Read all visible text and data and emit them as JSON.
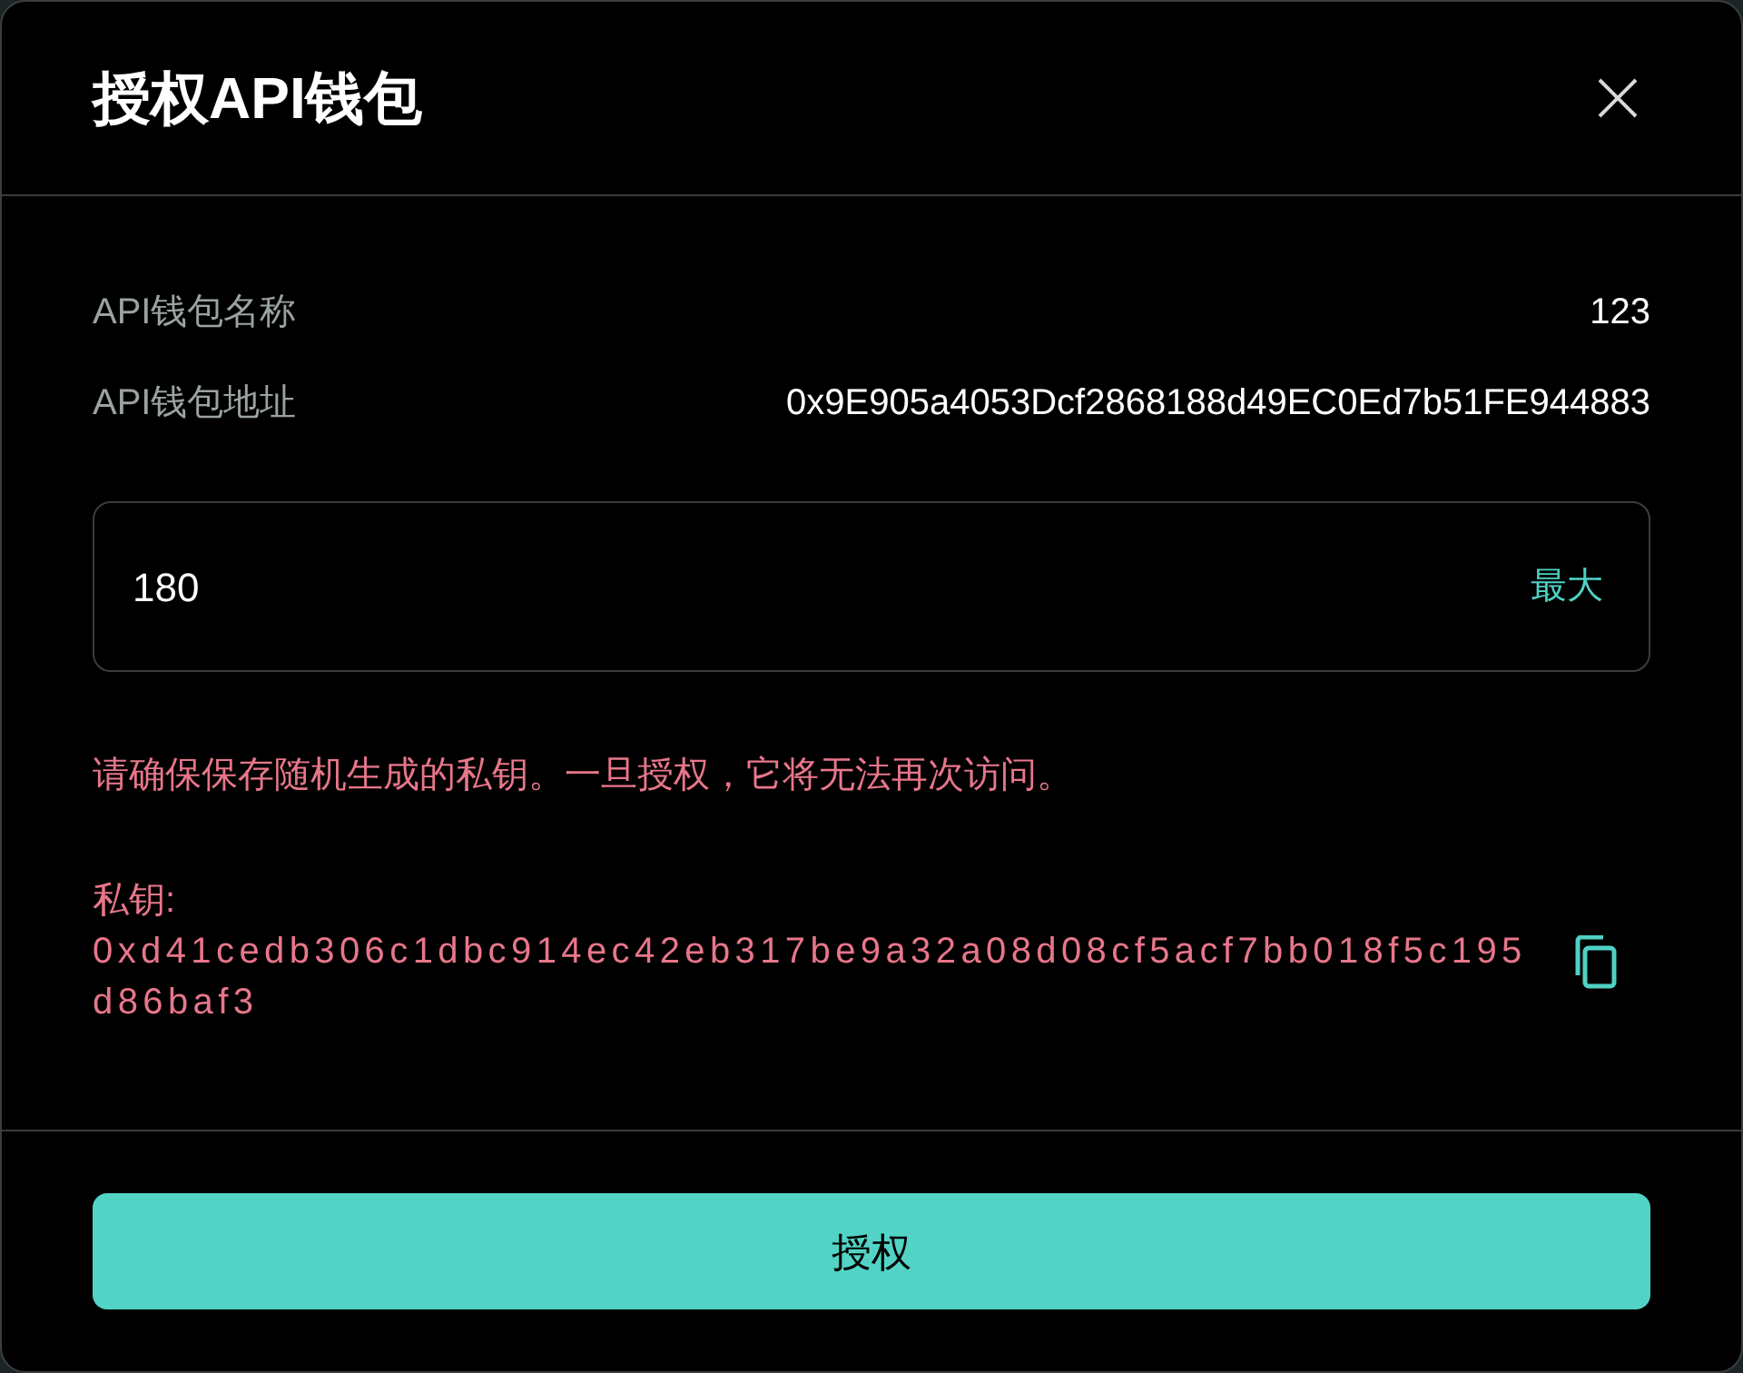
{
  "dialog": {
    "title": "授权API钱包"
  },
  "details": [
    {
      "label": "API钱包名称",
      "value": "123"
    },
    {
      "label": "API钱包地址",
      "value": "0x9E905a4053Dcf2868188d49EC0Ed7b51FE944883"
    }
  ],
  "amount_field": {
    "value": "180",
    "max_label": "最大"
  },
  "warning": "请确保保存随机生成的私钥。一旦授权，它将无法再次访问。",
  "private_key": {
    "label": "私钥:",
    "value": "0xd41cedb306c1dbc914ec42eb317be9a32a08d08cf5acf7bb018f5c195d86baf3"
  },
  "buttons": [
    {
      "label": "授权",
      "kind": "primary"
    }
  ]
}
